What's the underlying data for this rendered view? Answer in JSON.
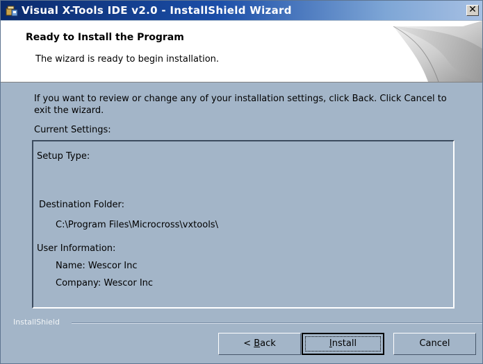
{
  "window": {
    "title": "Visual X-Tools IDE v2.0 - InstallShield Wizard",
    "close_glyph": "✕"
  },
  "header": {
    "title": "Ready to Install the Program",
    "subtitle": "The wizard is ready to begin installation."
  },
  "body": {
    "instructions": "If you want to review or change any of your installation settings, click Back. Click Cancel to exit the wizard.",
    "settings_label": "Current Settings:",
    "settings": {
      "setup_type_label": "Setup Type:",
      "destination_label": "Destination Folder:",
      "destination_path": "C:\\Program Files\\Microcross\\vxtools\\",
      "user_info_label": "User Information:",
      "name": "Name: Wescor Inc",
      "company": "Company: Wescor Inc"
    }
  },
  "footer": {
    "brand": "InstallShield",
    "back_prefix": "< ",
    "back_mnemonic": "B",
    "back_rest": "ack",
    "install_mnemonic": "I",
    "install_rest": "nstall",
    "cancel_label": "Cancel"
  },
  "colors": {
    "dialog_bg": "#a3b5c8",
    "title_gradient_start": "#0a2a6b",
    "title_gradient_end": "#a7c0e3"
  }
}
